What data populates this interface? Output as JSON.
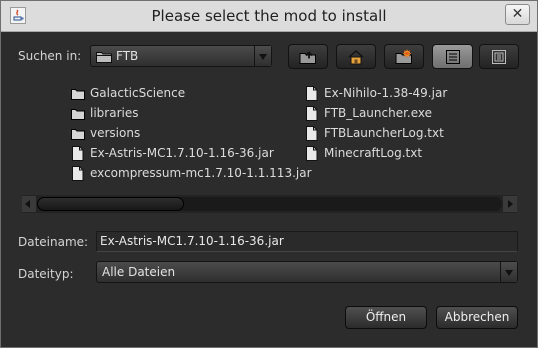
{
  "window": {
    "title": "Please select the mod to install",
    "close_label": "✕"
  },
  "lookin": {
    "label": "Suchen in:",
    "folder": "FTB"
  },
  "toolbar": {
    "buttons": [
      "up-one-level",
      "home",
      "new-folder",
      "list-view",
      "details-view"
    ]
  },
  "files": {
    "col1": [
      {
        "name": "GalacticScience",
        "kind": "folder"
      },
      {
        "name": "libraries",
        "kind": "folder"
      },
      {
        "name": "versions",
        "kind": "folder"
      },
      {
        "name": "Ex-Astris-MC1.7.10-1.16-36.jar",
        "kind": "file"
      },
      {
        "name": "excompressum-mc1.7.10-1.1.113.jar",
        "kind": "file"
      }
    ],
    "col2": [
      {
        "name": "Ex-Nihilo-1.38-49.jar",
        "kind": "file"
      },
      {
        "name": "FTB_Launcher.exe",
        "kind": "file"
      },
      {
        "name": "FTBLauncherLog.txt",
        "kind": "file"
      },
      {
        "name": "MinecraftLog.txt",
        "kind": "file"
      }
    ]
  },
  "filename": {
    "label": "Dateiname:",
    "value": "Ex-Astris-MC1.7.10-1.16-36.jar"
  },
  "filetype": {
    "label": "Dateityp:",
    "value": "Alle Dateien"
  },
  "buttons": {
    "open": "Öffnen",
    "cancel": "Abbrechen"
  }
}
